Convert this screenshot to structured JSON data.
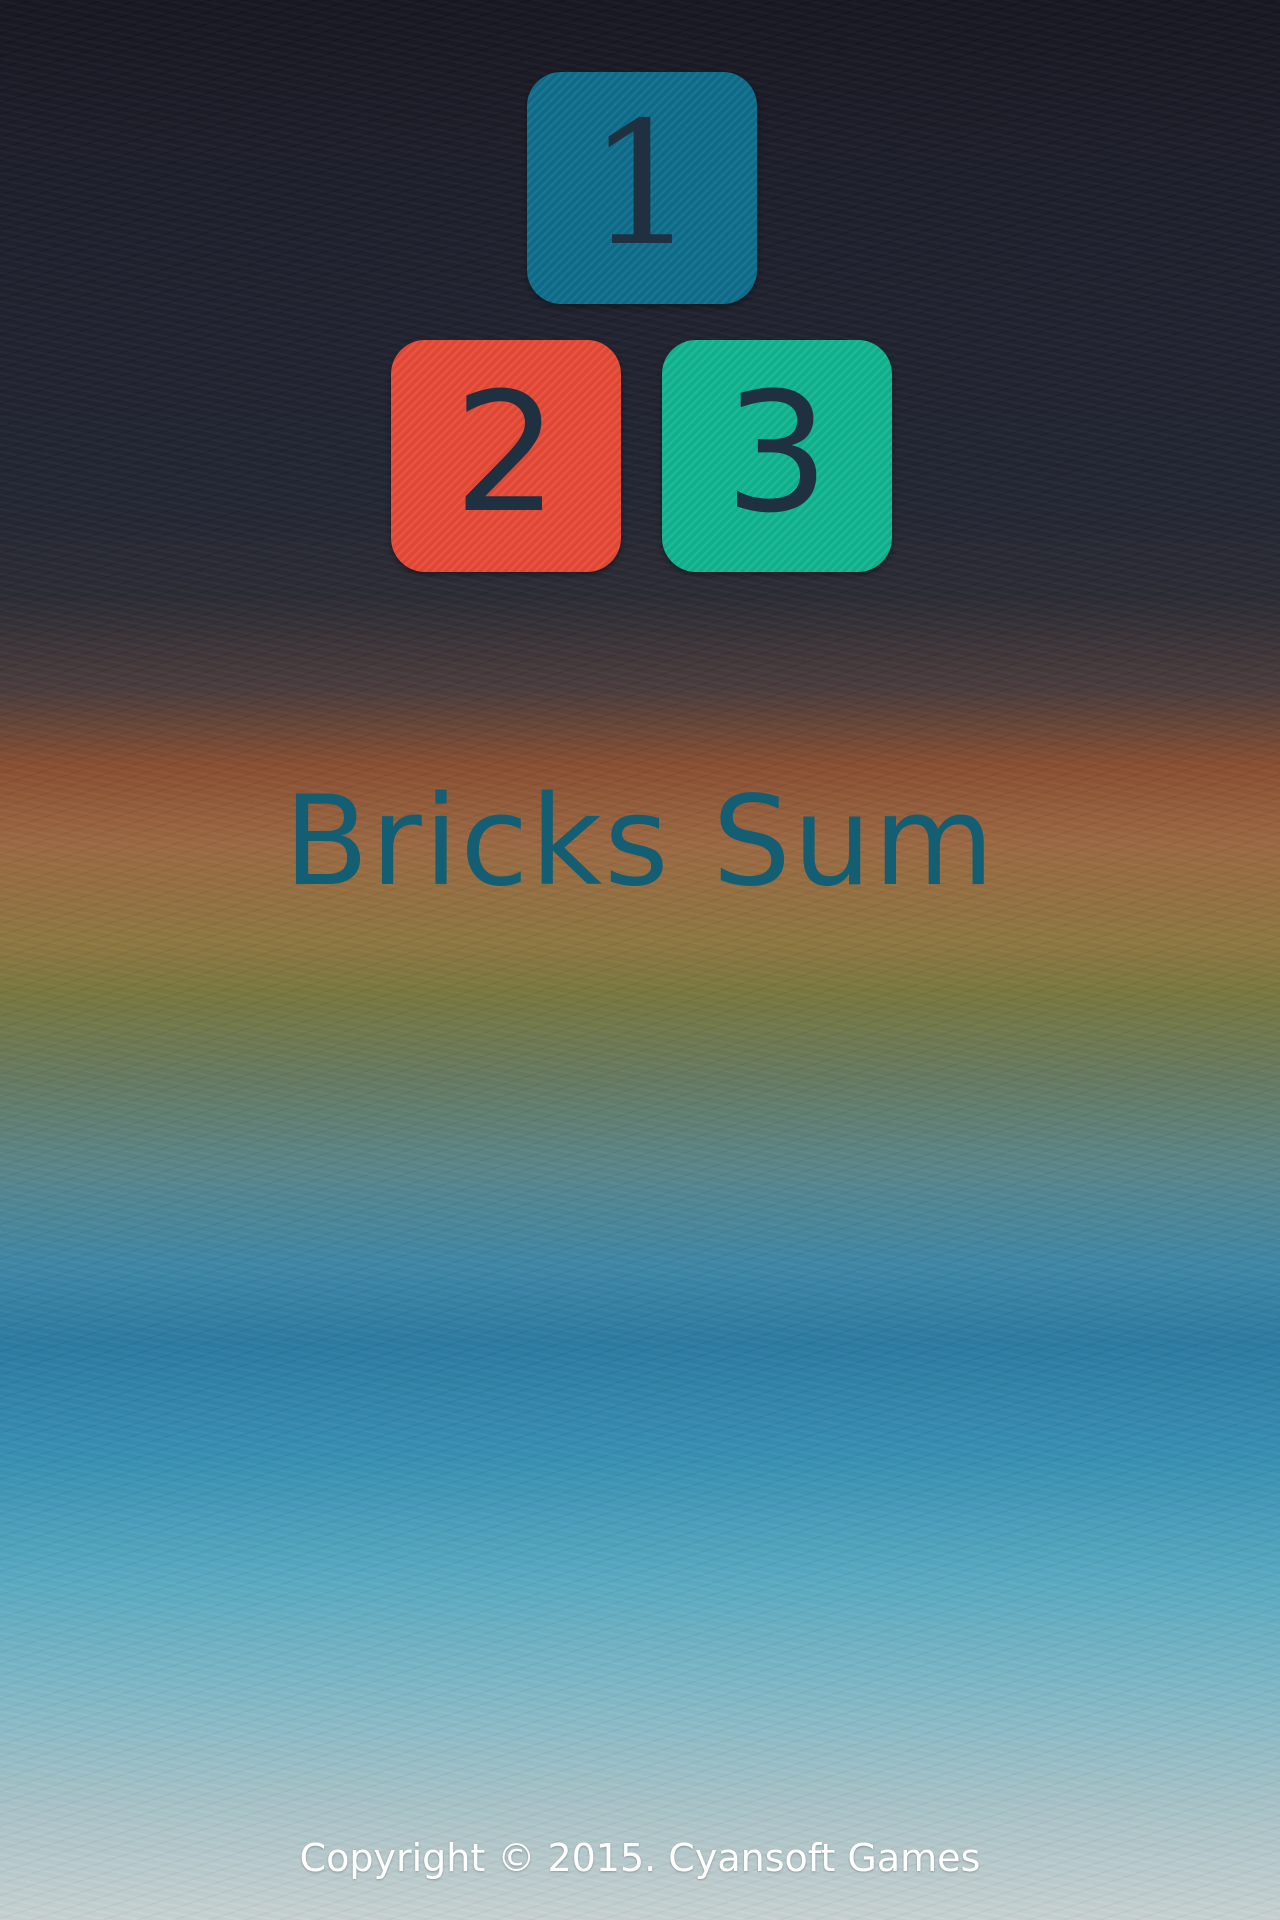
{
  "logo": {
    "bricks": [
      {
        "number": "1",
        "color": "#0e6e8c"
      },
      {
        "number": "2",
        "color": "#e84a37"
      },
      {
        "number": "3",
        "color": "#12b591"
      }
    ]
  },
  "title": "Bricks Sum",
  "footer": {
    "copyright": "Copyright © 2015. Cyansoft Games"
  },
  "colors": {
    "title": "#135e72",
    "brick_digit": "#1f3040"
  }
}
